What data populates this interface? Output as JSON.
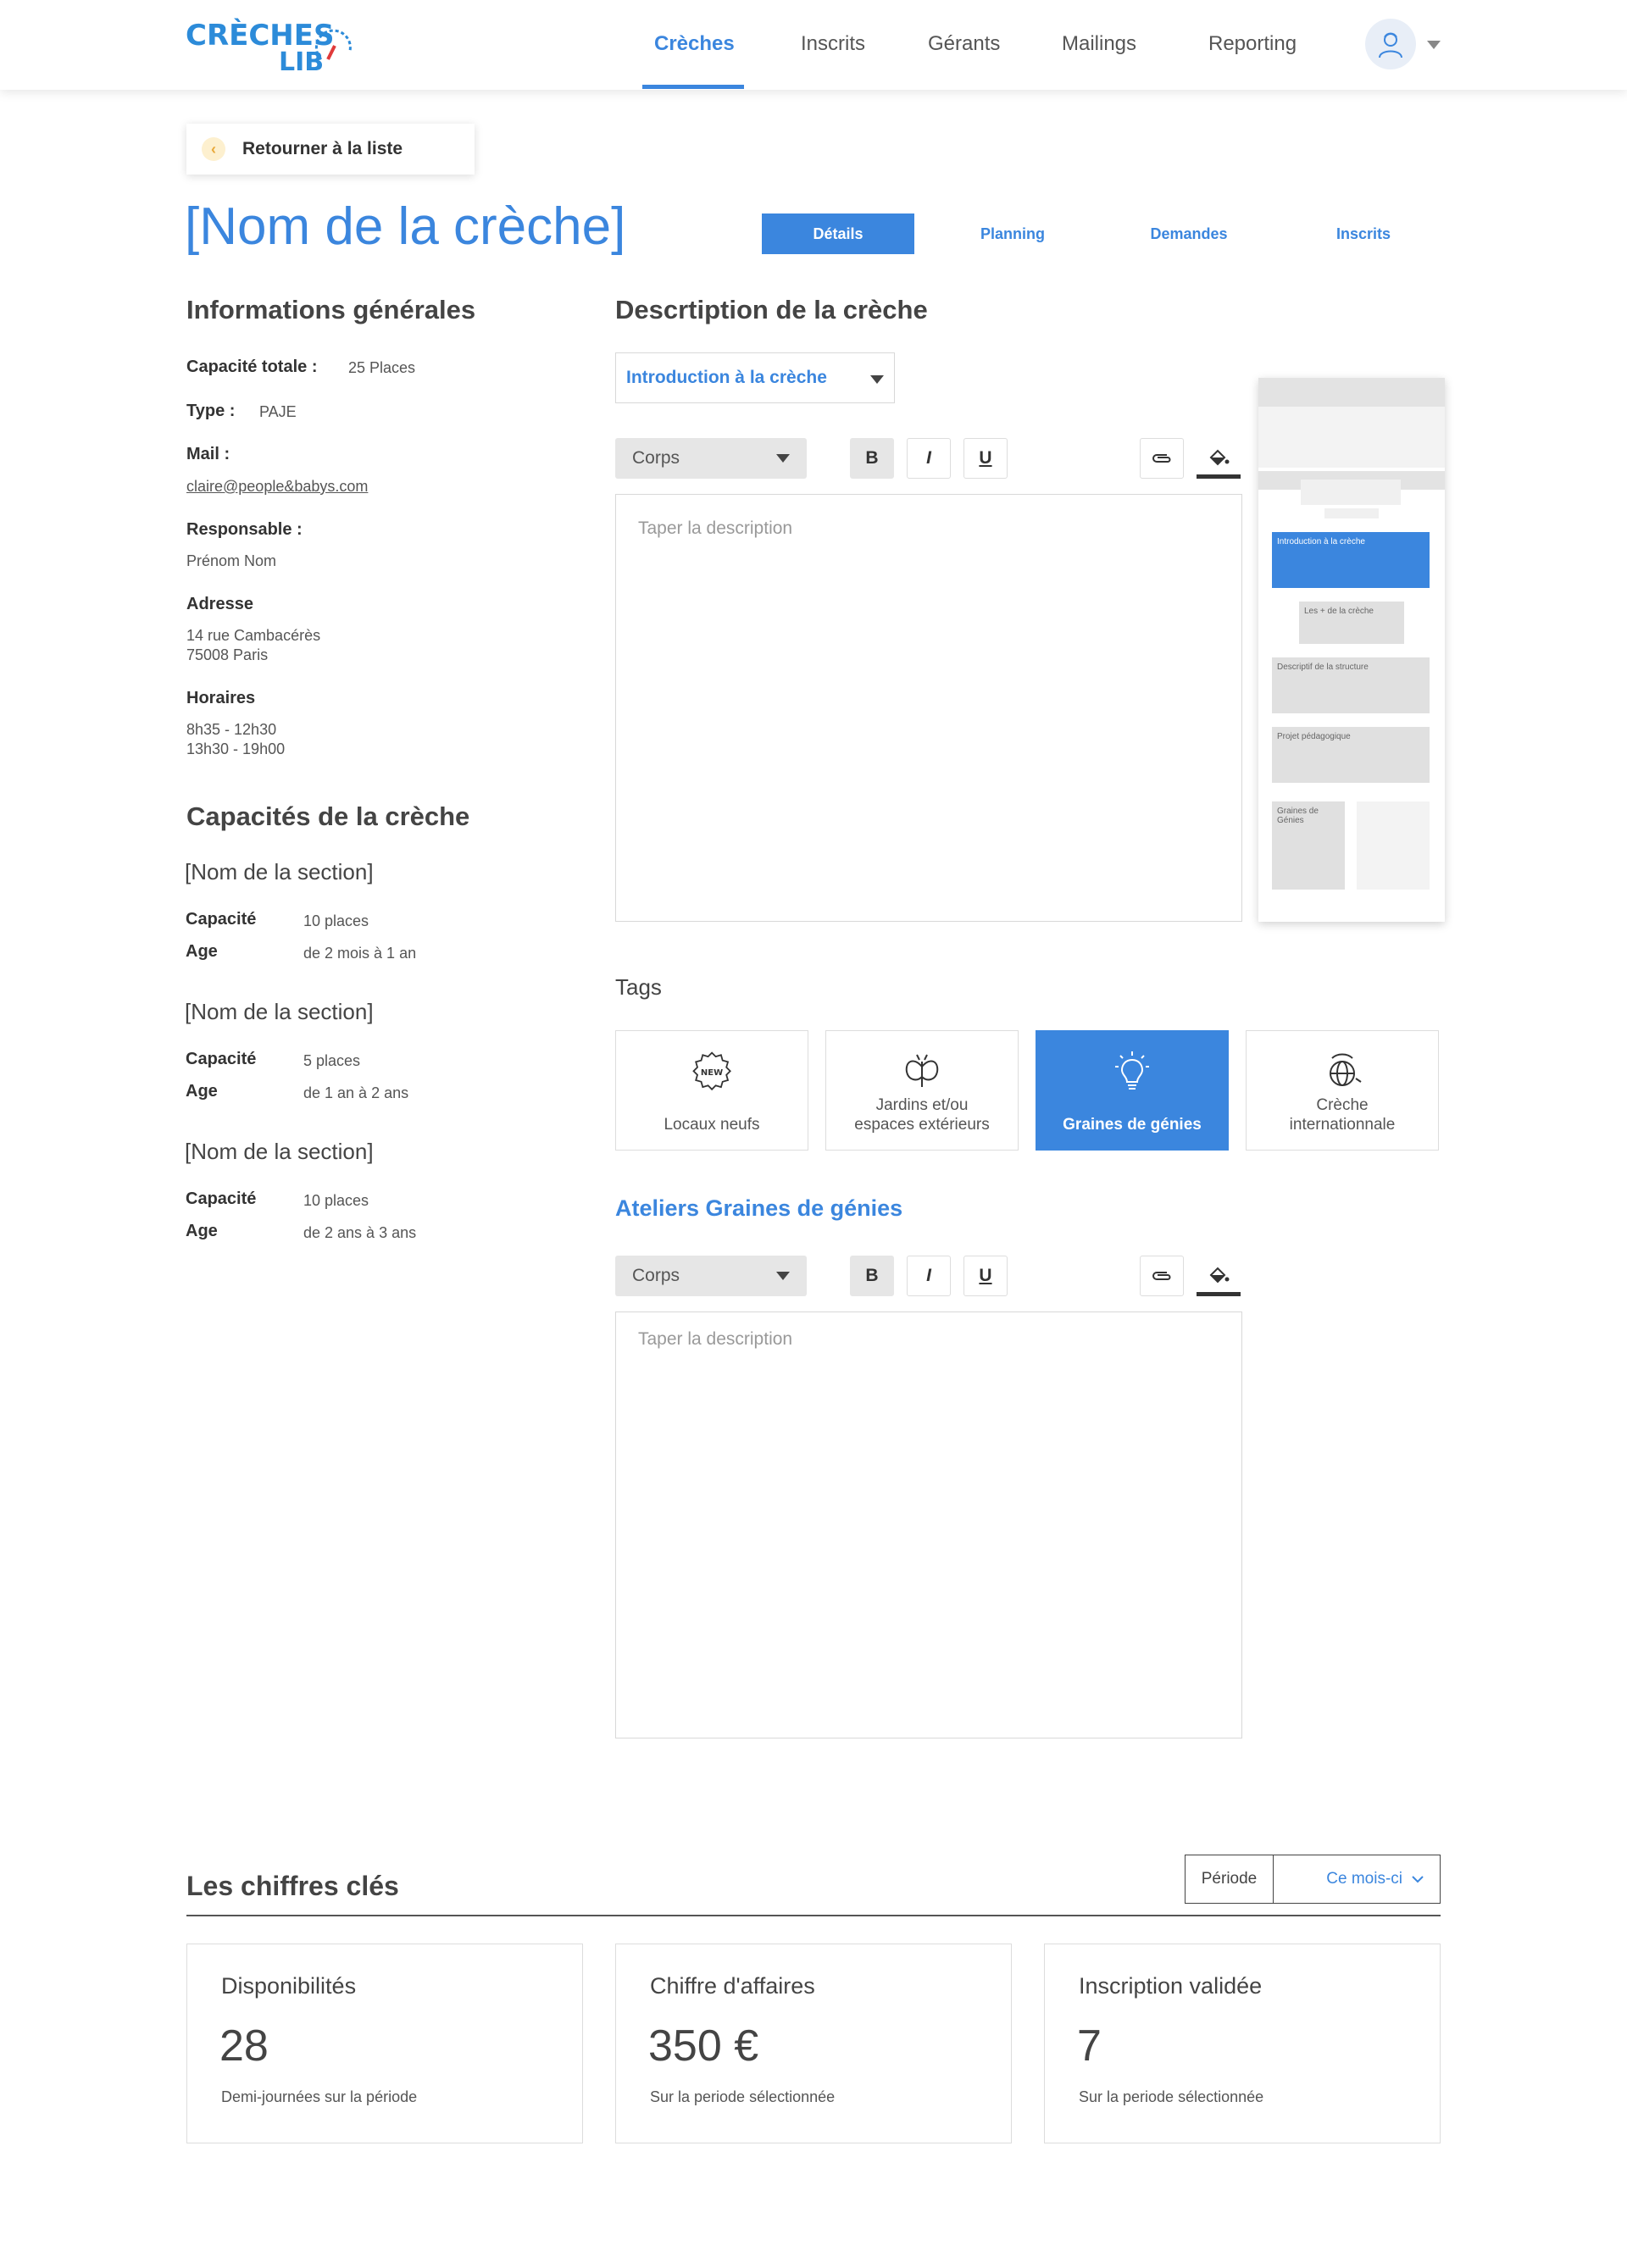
{
  "brand": {
    "line1": "CRÈCHES",
    "line2": "LIB"
  },
  "nav": {
    "items": [
      "Crèches",
      "Inscrits",
      "Gérants",
      "Mailings",
      "Reporting"
    ],
    "active": "Crèches"
  },
  "back": {
    "label": "Retourner à la liste"
  },
  "page": {
    "title": "[Nom de la crèche]"
  },
  "tabs": [
    "Détails",
    "Planning",
    "Demandes",
    "Inscrits"
  ],
  "info": {
    "heading": "Informations générales",
    "capacity_label": "Capacité totale :",
    "capacity_value": "25 Places",
    "type_label": "Type :",
    "type_value": "PAJE",
    "mail_label": "Mail :",
    "mail_value": "claire@people&babys.com",
    "manager_label": "Responsable :",
    "manager_value": "Prénom Nom",
    "address_label": "Adresse",
    "address_line1": "14 rue Cambacérès",
    "address_line2": "75008 Paris",
    "hours_label": "Horaires",
    "hours_line1": "8h35 - 12h30",
    "hours_line2": "13h30 - 19h00"
  },
  "capacities": {
    "heading": "Capacités de la crèche",
    "capacity_label": "Capacité",
    "age_label": "Age",
    "sections": [
      {
        "name": "[Nom de la section]",
        "capacity": "10 places",
        "age": "de 2 mois à 1 an"
      },
      {
        "name": "[Nom de la section]",
        "capacity": "5 places",
        "age": "de 1 an à 2 ans"
      },
      {
        "name": "[Nom de la section]",
        "capacity": "10 places",
        "age": "de 2 ans à 3 ans"
      }
    ]
  },
  "description": {
    "heading": "Descrtiption de la crèche",
    "dropdown_value": "Introduction à la crèche",
    "format_value": "Corps",
    "toolbar": {
      "bold": "B",
      "italic": "I",
      "underline": "U"
    },
    "placeholder": "Taper la description"
  },
  "preview": {
    "blocks": [
      "Introduction à la crèche",
      "Les + de la crèche",
      "Descriptif de la structure",
      "Projet pédagogique",
      "Graines de Génies"
    ]
  },
  "tags": {
    "heading": "Tags",
    "items": [
      {
        "label": "Locaux neufs",
        "icon": "new-badge-icon",
        "active": false
      },
      {
        "label": "Jardins et/ou espaces extérieurs",
        "icon": "butterfly-icon",
        "active": false
      },
      {
        "label": "Graines de génies",
        "icon": "lightbulb-icon",
        "active": true
      },
      {
        "label": "Crèche internationnale",
        "icon": "globe-icon",
        "active": false
      }
    ],
    "new_badge_text": "NEW"
  },
  "atelier": {
    "heading": "Ateliers Graines de génies",
    "format_value": "Corps",
    "placeholder": "Taper la description"
  },
  "key_figures": {
    "heading": "Les chiffres clés",
    "period_label": "Période",
    "period_value": "Ce mois-ci",
    "cards": [
      {
        "title": "Disponibilités",
        "value": "28",
        "subtitle": "Demi-journées sur la période"
      },
      {
        "title": "Chiffre d'affaires",
        "value": "350 €",
        "subtitle": "Sur la periode sélectionnée"
      },
      {
        "title": "Inscription validée",
        "value": "7",
        "subtitle": "Sur la periode sélectionnée"
      }
    ]
  },
  "colors": {
    "accent": "#3b86de",
    "badge": "#fdf0cf"
  }
}
